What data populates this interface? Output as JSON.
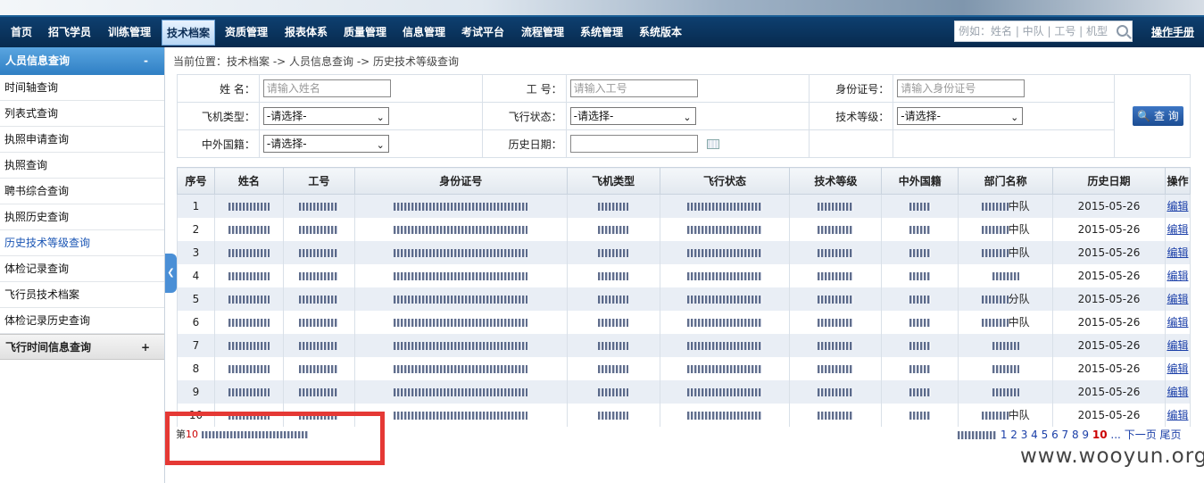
{
  "nav": {
    "items": [
      "首页",
      "招飞学员",
      "训练管理",
      "技术档案",
      "资质管理",
      "报表体系",
      "质量管理",
      "信息管理",
      "考试平台",
      "流程管理",
      "系统管理",
      "系统版本"
    ],
    "active": "技术档案",
    "search_placeholder": "例如：姓名 | 中队 | 工号 | 机型",
    "manual": "操作手册"
  },
  "sidebar": {
    "section1": "人员信息查询",
    "section1_toggle": "-",
    "items": [
      "时间轴查询",
      "列表式查询",
      "执照申请查询",
      "执照查询",
      "聘书综合查询",
      "执照历史查询",
      "历史技术等级查询",
      "体检记录查询",
      "飞行员技术档案",
      "体检记录历史查询"
    ],
    "active_item": "历史技术等级查询",
    "section2": "飞行时间信息查询",
    "section2_toggle": "+"
  },
  "breadcrumb": "当前位置：技术档案 -> 人员信息查询 -> 历史技术等级查询",
  "form": {
    "name_label": "姓  名：",
    "name_placeholder": "请输入姓名",
    "id_label": "工  号：",
    "id_placeholder": "请输入工号",
    "idcard_label": "身份证号：",
    "idcard_placeholder": "请输入身份证号",
    "aircraft_label": "飞机类型：",
    "aircraft_value": "-请选择-",
    "flight_status_label": "飞行状态：",
    "flight_status_value": "-请选择-",
    "tech_level_label": "技术等级：",
    "tech_level_value": "-请选择-",
    "nationality_label": "中外国籍：",
    "nationality_value": "-请选择-",
    "history_date_label": "历史日期：",
    "query_button": "查 询"
  },
  "table": {
    "headers": [
      "序号",
      "姓名",
      "工号",
      "身份证号",
      "飞机类型",
      "飞行状态",
      "技术等级",
      "中外国籍",
      "部门名称",
      "历史日期",
      "操作"
    ],
    "rows": [
      {
        "no": "1",
        "dept_suffix": "中队",
        "date": "2015-05-26",
        "op": "编辑"
      },
      {
        "no": "2",
        "dept_suffix": "中队",
        "date": "2015-05-26",
        "op": "编辑"
      },
      {
        "no": "3",
        "dept_suffix": "中队",
        "date": "2015-05-26",
        "op": "编辑"
      },
      {
        "no": "4",
        "dept_suffix": "",
        "date": "2015-05-26",
        "op": "编辑"
      },
      {
        "no": "5",
        "dept_suffix": "分队",
        "date": "2015-05-26",
        "op": "编辑"
      },
      {
        "no": "6",
        "dept_suffix": "中队",
        "date": "2015-05-26",
        "op": "编辑"
      },
      {
        "no": "7",
        "dept_suffix": "",
        "date": "2015-05-26",
        "op": "编辑"
      },
      {
        "no": "8",
        "dept_suffix": "",
        "date": "2015-05-26",
        "op": "编辑"
      },
      {
        "no": "9",
        "dept_suffix": "",
        "date": "2015-05-26",
        "op": "编辑"
      },
      {
        "no": "10",
        "dept_suffix": "中队",
        "date": "2015-05-26",
        "op": "编辑"
      }
    ]
  },
  "pager": {
    "left_prefix": "第",
    "left_current": "10",
    "numbers": "1 2 3 4 5 6 7 8 9",
    "current": "10",
    "ellipsis": "...",
    "next": "下一页",
    "last": "尾页"
  },
  "watermark": "www.wooyun.org",
  "colors": {
    "highlight_box": "#e53935",
    "nav_bg": "#0e3f70",
    "sidebar_head": "#2f7fc4"
  }
}
